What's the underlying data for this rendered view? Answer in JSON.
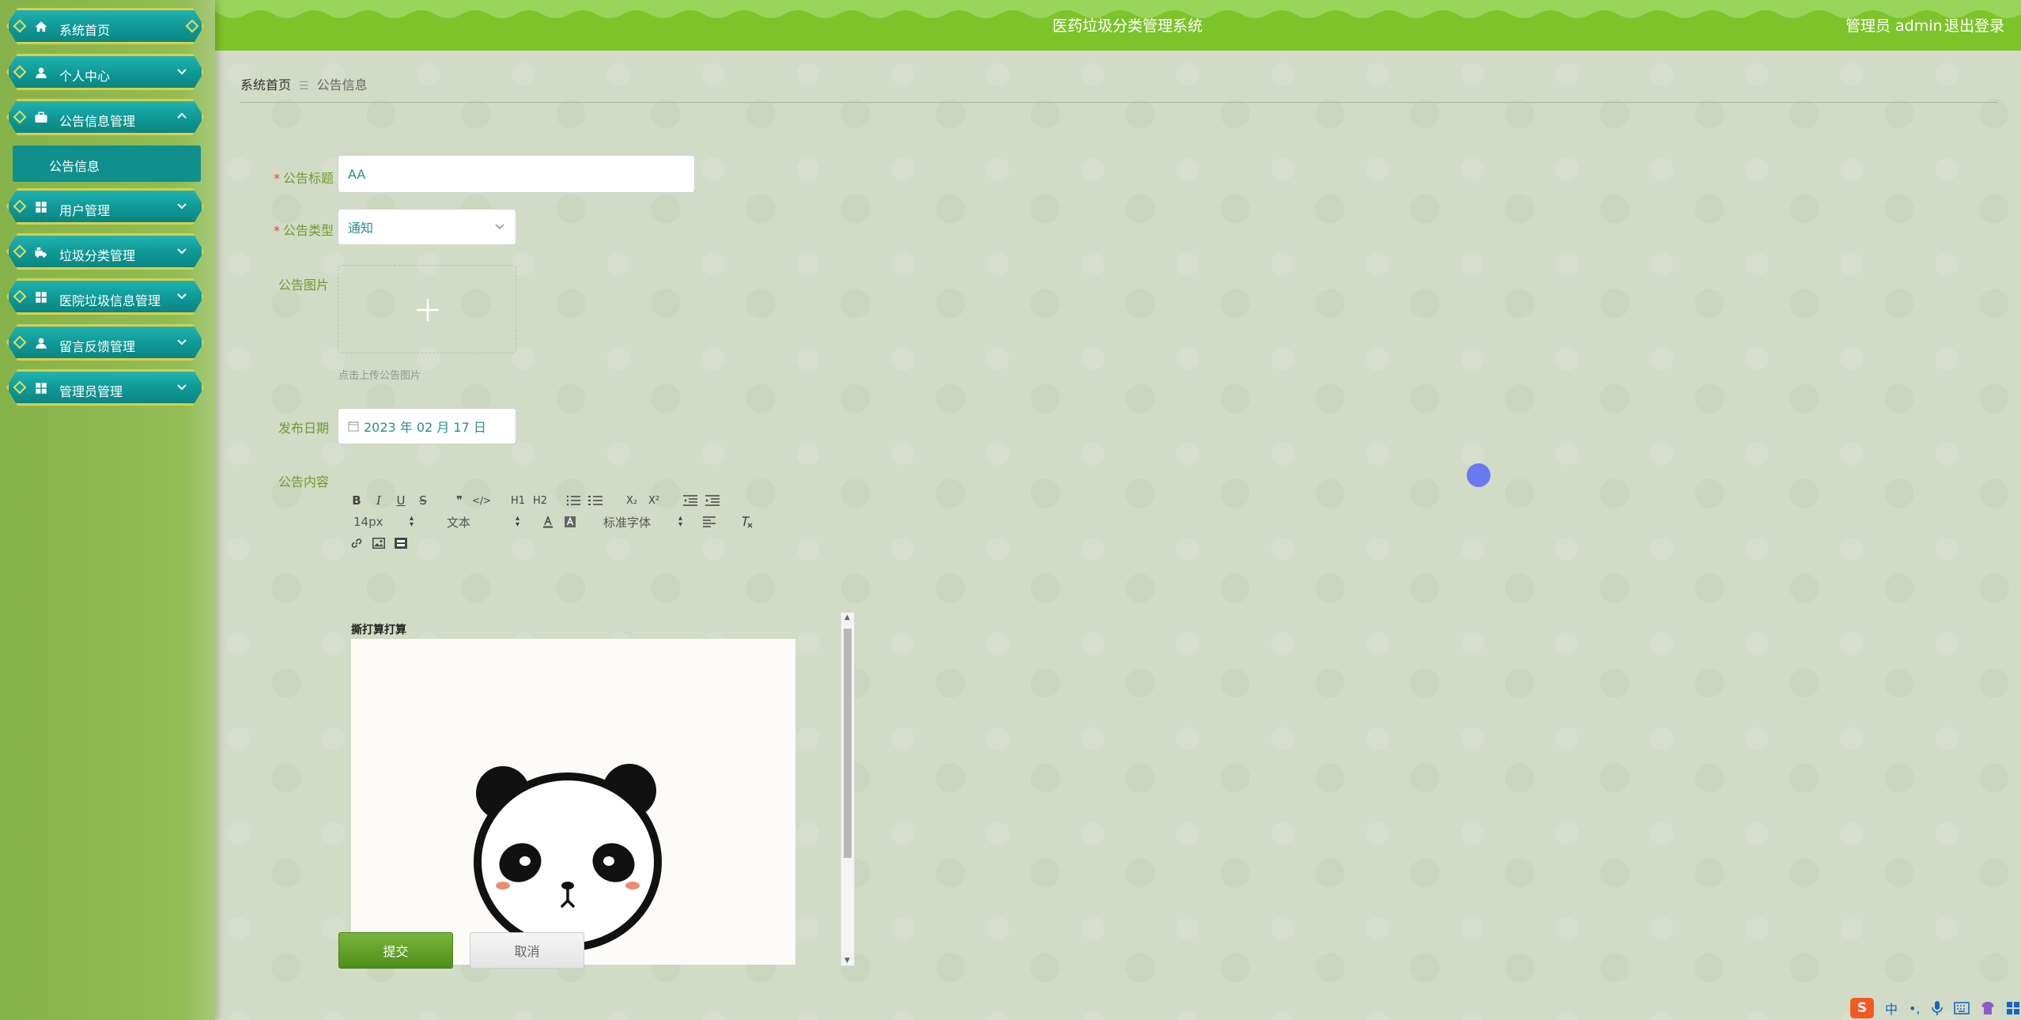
{
  "header": {
    "title": "医药垃圾分类管理系统",
    "user_role": "管理员 admin",
    "logout_label": "退出登录"
  },
  "sidebar": {
    "items": [
      {
        "label": "系统首页",
        "icon": "home-icon"
      },
      {
        "label": "个人中心",
        "icon": "user-icon"
      },
      {
        "label": "公告信息管理",
        "icon": "briefcase-icon",
        "expanded": true
      },
      {
        "label": "用户管理",
        "icon": "grid-icon"
      },
      {
        "label": "垃圾分类管理",
        "icon": "truck-icon"
      },
      {
        "label": "医院垃圾信息管理",
        "icon": "grid-icon"
      },
      {
        "label": "留言反馈管理",
        "icon": "user-icon"
      },
      {
        "label": "管理员管理",
        "icon": "grid-icon"
      }
    ],
    "active_sub_item": "公告信息"
  },
  "breadcrumb": {
    "home": "系统首页",
    "separator": "☰",
    "current": "公告信息"
  },
  "form": {
    "title_label": "公告标题",
    "title_value": "AA",
    "type_label": "公告类型",
    "type_value": "通知",
    "image_label": "公告图片",
    "upload_tip": "点击上传公告图片",
    "date_label": "发布日期",
    "date_value": "2023 年 02 月 17 日",
    "content_label": "公告内容",
    "content_text": "撕打算打算",
    "submit_label": "提交",
    "cancel_label": "取消"
  },
  "editor": {
    "row1": [
      "B",
      "I",
      "U",
      "S",
      "❞",
      "</>",
      "H1",
      "H2",
      "ol-icon",
      "ul-icon",
      "X₂",
      "X²",
      "outdent-icon",
      "indent-icon"
    ],
    "font_size": "14px",
    "heading": "文本",
    "font_family": "标准字体",
    "row3": [
      "link-icon",
      "image-icon",
      "video-icon"
    ]
  },
  "tray": {
    "ime_logo": "S",
    "ime_lang": "中",
    "ime_punct": "•,"
  },
  "colors": {
    "header": "#7cc42a",
    "sidebar": "#8ab64d",
    "menu": "#0e9896",
    "menu_border": "#d8d04a",
    "label": "#6f9a2f",
    "required": "#e04848",
    "submit": "#5a9b22"
  }
}
